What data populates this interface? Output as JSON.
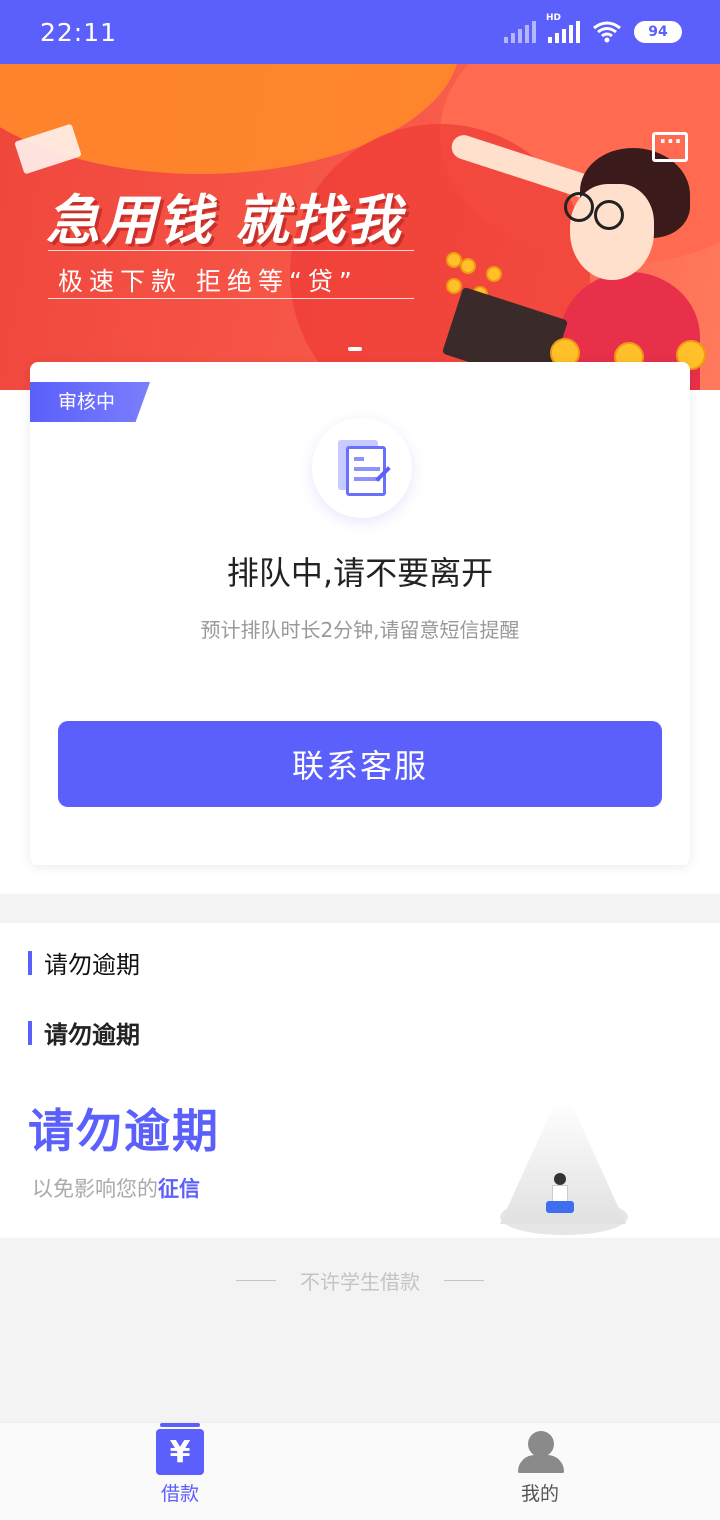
{
  "status_bar": {
    "time": "22:11",
    "network_label": "HD",
    "battery": "94"
  },
  "banner": {
    "title": "急用钱 就找我",
    "subtitle": "极速下款  拒绝等“贷”",
    "chat_icon": "chat-bubble-icon",
    "colors": {
      "background": "#f0463c",
      "accent": "#ff8a2a"
    }
  },
  "status_card": {
    "badge": "审核中",
    "title": "排队中,请不要离开",
    "subtitle": "预计排队时长2分钟,请留意短信提醒",
    "button": "联系客服",
    "icon": "document-icon"
  },
  "overdue": {
    "header1": "请勿逾期",
    "header2": "请勿逾期",
    "big_text": "请勿逾期",
    "sub_text_prefix": "以免影响您的",
    "sub_text_highlight": "征信"
  },
  "footer_note": "不许学生借款",
  "tabbar": {
    "tabs": [
      {
        "label": "借款",
        "icon": "yen-icon",
        "active": true
      },
      {
        "label": "我的",
        "icon": "user-icon",
        "active": false
      }
    ]
  },
  "colors": {
    "primary": "#5b5ffb",
    "muted": "#999999"
  }
}
